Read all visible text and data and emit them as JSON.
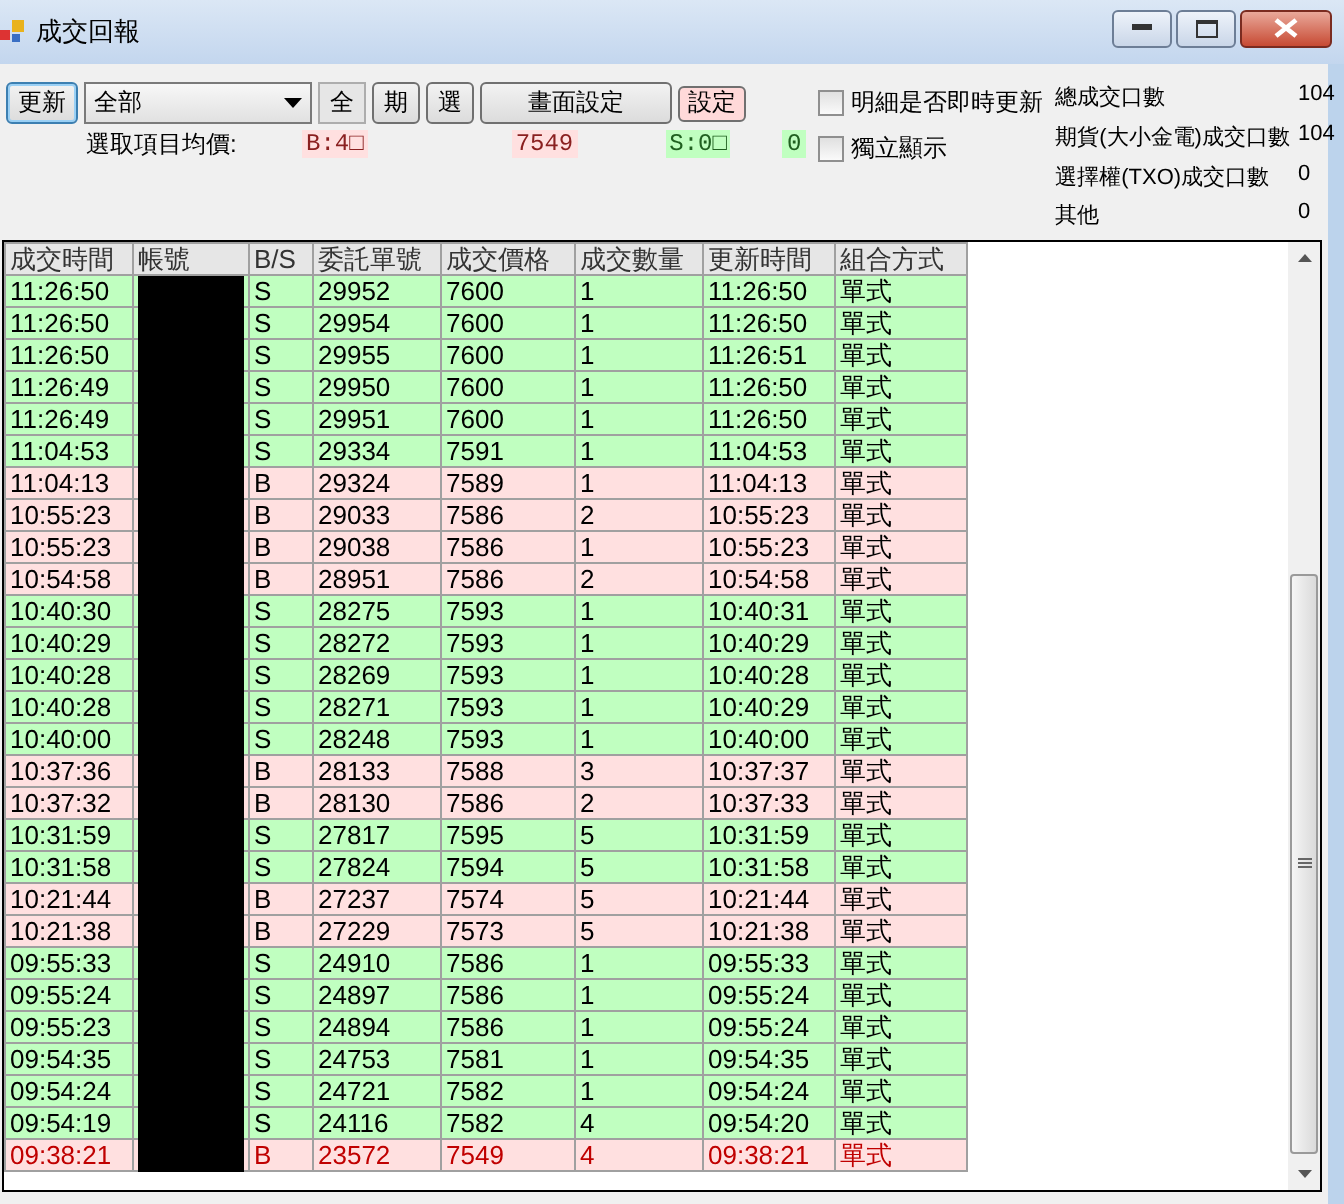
{
  "window": {
    "title": "成交回報"
  },
  "toolbar": {
    "refresh_button": "更新",
    "filter_select": {
      "value": "全部"
    },
    "buttons": [
      {
        "label": "全",
        "selected": true
      },
      {
        "label": "期",
        "selected": false
      },
      {
        "label": "選",
        "selected": false
      },
      {
        "label": "畫面設定",
        "selected": false
      }
    ],
    "settings_button": "設定",
    "avg_price": {
      "label": "選取項目均價:",
      "buy_label": "B:4□",
      "buy_price": "7549",
      "sell_label": "S:0□",
      "sell_price": "0"
    },
    "checkboxes": [
      {
        "label": "明細是否即時更新",
        "checked": false
      },
      {
        "label": "獨立顯示",
        "checked": false
      }
    ]
  },
  "stats": [
    {
      "label": "總成交口數",
      "value": "104"
    },
    {
      "label": "期貨(大小金電)成交口數",
      "value": "104"
    },
    {
      "label": "選擇權(TXO)成交口數",
      "value": "0"
    },
    {
      "label": "其他",
      "value": "0"
    }
  ],
  "table": {
    "columns": [
      "成交時間",
      "帳號",
      "B/S",
      "委託單號",
      "成交價格",
      "成交數量",
      "更新時間",
      "組合方式"
    ],
    "rows": [
      {
        "time": "11:26:50",
        "side": "S",
        "order": "29952",
        "price": "7600",
        "qty": "1",
        "updated": "11:26:50",
        "combo": "單式",
        "highlighted": false
      },
      {
        "time": "11:26:50",
        "side": "S",
        "order": "29954",
        "price": "7600",
        "qty": "1",
        "updated": "11:26:50",
        "combo": "單式",
        "highlighted": false
      },
      {
        "time": "11:26:50",
        "side": "S",
        "order": "29955",
        "price": "7600",
        "qty": "1",
        "updated": "11:26:51",
        "combo": "單式",
        "highlighted": false
      },
      {
        "time": "11:26:49",
        "side": "S",
        "order": "29950",
        "price": "7600",
        "qty": "1",
        "updated": "11:26:50",
        "combo": "單式",
        "highlighted": false
      },
      {
        "time": "11:26:49",
        "side": "S",
        "order": "29951",
        "price": "7600",
        "qty": "1",
        "updated": "11:26:50",
        "combo": "單式",
        "highlighted": false
      },
      {
        "time": "11:04:53",
        "side": "S",
        "order": "29334",
        "price": "7591",
        "qty": "1",
        "updated": "11:04:53",
        "combo": "單式",
        "highlighted": false
      },
      {
        "time": "11:04:13",
        "side": "B",
        "order": "29324",
        "price": "7589",
        "qty": "1",
        "updated": "11:04:13",
        "combo": "單式",
        "highlighted": false
      },
      {
        "time": "10:55:23",
        "side": "B",
        "order": "29033",
        "price": "7586",
        "qty": "2",
        "updated": "10:55:23",
        "combo": "單式",
        "highlighted": false
      },
      {
        "time": "10:55:23",
        "side": "B",
        "order": "29038",
        "price": "7586",
        "qty": "1",
        "updated": "10:55:23",
        "combo": "單式",
        "highlighted": false
      },
      {
        "time": "10:54:58",
        "side": "B",
        "order": "28951",
        "price": "7586",
        "qty": "2",
        "updated": "10:54:58",
        "combo": "單式",
        "highlighted": false
      },
      {
        "time": "10:40:30",
        "side": "S",
        "order": "28275",
        "price": "7593",
        "qty": "1",
        "updated": "10:40:31",
        "combo": "單式",
        "highlighted": false
      },
      {
        "time": "10:40:29",
        "side": "S",
        "order": "28272",
        "price": "7593",
        "qty": "1",
        "updated": "10:40:29",
        "combo": "單式",
        "highlighted": false
      },
      {
        "time": "10:40:28",
        "side": "S",
        "order": "28269",
        "price": "7593",
        "qty": "1",
        "updated": "10:40:28",
        "combo": "單式",
        "highlighted": false
      },
      {
        "time": "10:40:28",
        "side": "S",
        "order": "28271",
        "price": "7593",
        "qty": "1",
        "updated": "10:40:29",
        "combo": "單式",
        "highlighted": false
      },
      {
        "time": "10:40:00",
        "side": "S",
        "order": "28248",
        "price": "7593",
        "qty": "1",
        "updated": "10:40:00",
        "combo": "單式",
        "highlighted": false
      },
      {
        "time": "10:37:36",
        "side": "B",
        "order": "28133",
        "price": "7588",
        "qty": "3",
        "updated": "10:37:37",
        "combo": "單式",
        "highlighted": false
      },
      {
        "time": "10:37:32",
        "side": "B",
        "order": "28130",
        "price": "7586",
        "qty": "2",
        "updated": "10:37:33",
        "combo": "單式",
        "highlighted": false
      },
      {
        "time": "10:31:59",
        "side": "S",
        "order": "27817",
        "price": "7595",
        "qty": "5",
        "updated": "10:31:59",
        "combo": "單式",
        "highlighted": false
      },
      {
        "time": "10:31:58",
        "side": "S",
        "order": "27824",
        "price": "7594",
        "qty": "5",
        "updated": "10:31:58",
        "combo": "單式",
        "highlighted": false
      },
      {
        "time": "10:21:44",
        "side": "B",
        "order": "27237",
        "price": "7574",
        "qty": "5",
        "updated": "10:21:44",
        "combo": "單式",
        "highlighted": false
      },
      {
        "time": "10:21:38",
        "side": "B",
        "order": "27229",
        "price": "7573",
        "qty": "5",
        "updated": "10:21:38",
        "combo": "單式",
        "highlighted": false
      },
      {
        "time": "09:55:33",
        "side": "S",
        "order": "24910",
        "price": "7586",
        "qty": "1",
        "updated": "09:55:33",
        "combo": "單式",
        "highlighted": false
      },
      {
        "time": "09:55:24",
        "side": "S",
        "order": "24897",
        "price": "7586",
        "qty": "1",
        "updated": "09:55:24",
        "combo": "單式",
        "highlighted": false
      },
      {
        "time": "09:55:23",
        "side": "S",
        "order": "24894",
        "price": "7586",
        "qty": "1",
        "updated": "09:55:24",
        "combo": "單式",
        "highlighted": false
      },
      {
        "time": "09:54:35",
        "side": "S",
        "order": "24753",
        "price": "7581",
        "qty": "1",
        "updated": "09:54:35",
        "combo": "單式",
        "highlighted": false
      },
      {
        "time": "09:54:24",
        "side": "S",
        "order": "24721",
        "price": "7582",
        "qty": "1",
        "updated": "09:54:24",
        "combo": "單式",
        "highlighted": false
      },
      {
        "time": "09:54:19",
        "side": "S",
        "order": "24116",
        "price": "7582",
        "qty": "4",
        "updated": "09:54:20",
        "combo": "單式",
        "highlighted": false
      },
      {
        "time": "09:38:21",
        "side": "B",
        "order": "23572",
        "price": "7549",
        "qty": "4",
        "updated": "09:38:21",
        "combo": "單式",
        "highlighted": true
      }
    ]
  }
}
